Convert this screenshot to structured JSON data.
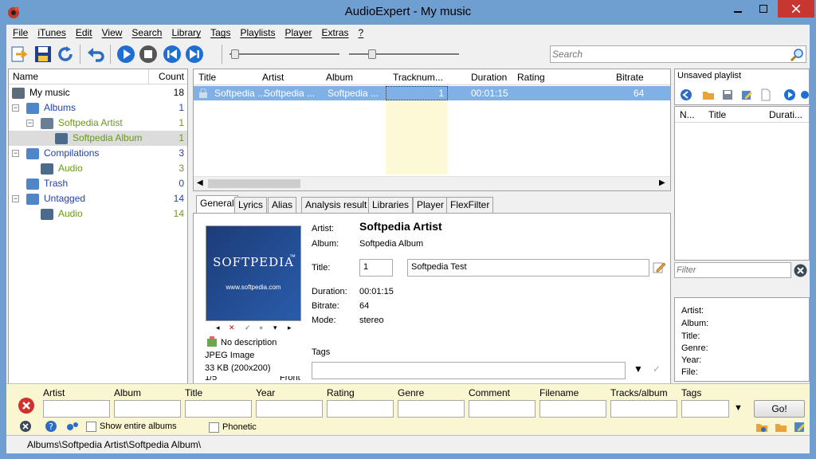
{
  "window": {
    "title": "AudioExpert - My music"
  },
  "menu": [
    "File",
    "iTunes",
    "Edit",
    "View",
    "Search",
    "Library",
    "Tags",
    "Playlists",
    "Player",
    "Extras",
    "?"
  ],
  "search": {
    "placeholder": "Search"
  },
  "tree": {
    "headers": {
      "name": "Name",
      "count": "Count"
    },
    "rows": [
      {
        "label": "My music",
        "count": "18",
        "color": "#000000"
      },
      {
        "label": "Albums",
        "count": "1",
        "color": "#1f3fb8"
      },
      {
        "label": "Softpedia Artist",
        "count": "1",
        "color": "#6a9a14"
      },
      {
        "label": "Softpedia Album",
        "count": "1",
        "color": "#6a9a14"
      },
      {
        "label": "Compilations",
        "count": "3",
        "color": "#1f3fb8"
      },
      {
        "label": "Audio",
        "count": "3",
        "color": "#6a9a14"
      },
      {
        "label": "Trash",
        "count": "0",
        "color": "#1f3fb8"
      },
      {
        "label": "Untagged",
        "count": "14",
        "color": "#1f3fb8"
      },
      {
        "label": "Audio",
        "count": "14",
        "color": "#6a9a14"
      }
    ]
  },
  "tracklist": {
    "columns": [
      "Title",
      "Artist",
      "Album",
      "Tracknum...",
      "Duration",
      "Rating",
      "Bitrate"
    ],
    "row": {
      "title": "Softpedia ...",
      "artist": "Softpedia ...",
      "album": "Softpedia ...",
      "tracknum": "1",
      "duration": "00:01:15",
      "rating": "",
      "bitrate": "64"
    }
  },
  "tabs": [
    "General",
    "Lyrics",
    "Alias",
    "Analysis result",
    "Libraries",
    "Player",
    "FlexFilter"
  ],
  "detail": {
    "cover_text": "SOFTPEDIA",
    "cover_tm": "™",
    "cover_url": "www.softpedia.com",
    "no_description": "No description",
    "image_type": "JPEG Image",
    "image_size": "33 KB  (200x200)",
    "image_index": "1/5",
    "image_pos": "Front",
    "artist_label": "Artist:",
    "artist": "Softpedia Artist",
    "album_label": "Album:",
    "album": "Softpedia Album",
    "title_label": "Title:",
    "track_number": "1",
    "title": "Softpedia Test",
    "duration_label": "Duration:",
    "duration": "00:01:15",
    "bitrate_label": "Bitrate:",
    "bitrate": "64",
    "mode_label": "Mode:",
    "mode": "stereo",
    "tags_label": "Tags"
  },
  "right": {
    "playlist_title": "Unsaved playlist",
    "columns": [
      "N...",
      "Title",
      "Durati..."
    ],
    "filter_placeholder": "Filter",
    "info_labels": [
      "Artist:",
      "Album:",
      "Title:",
      "Genre:",
      "Year:",
      "File:"
    ]
  },
  "bottom": {
    "fields": [
      "Artist",
      "Album",
      "Title",
      "Year",
      "Rating",
      "Genre",
      "Comment",
      "Filename",
      "Tracks/album",
      "Tags"
    ],
    "show_entire_albums": "Show entire albums",
    "phonetic": "Phonetic",
    "go": "Go!"
  },
  "status": {
    "path": "Albums\\Softpedia Artist\\Softpedia Album\\"
  },
  "colors": {
    "titlebar": "#6f9ed1",
    "selection": "#7fb1e6",
    "tracknum_column": "#fdf9d6",
    "filter_bar": "#fbf6d2"
  }
}
